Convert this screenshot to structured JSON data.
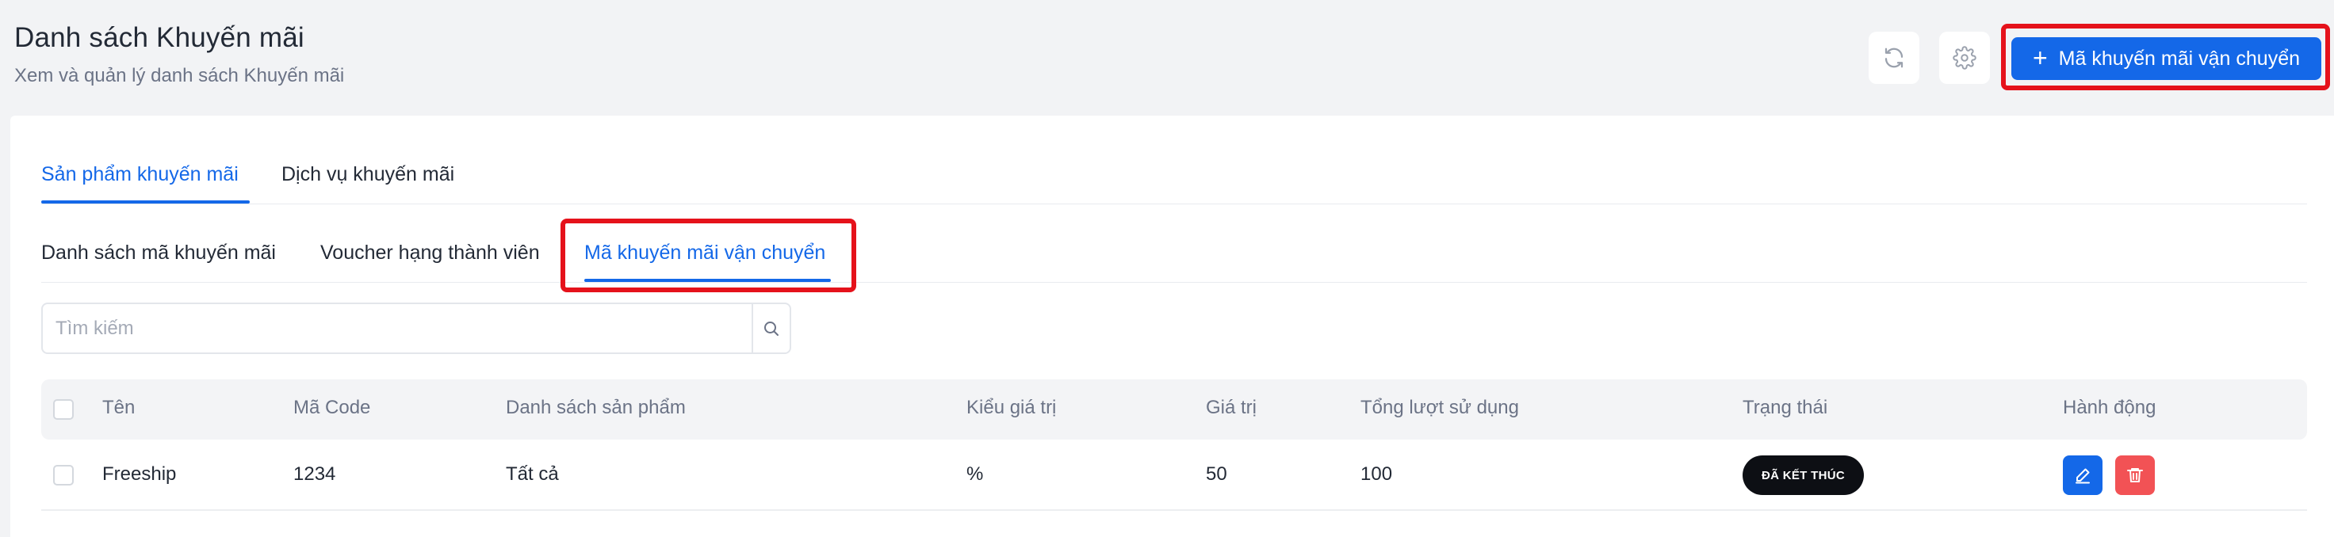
{
  "header": {
    "title": "Danh sách Khuyến mãi",
    "subtitle": "Xem và quản lý danh sách Khuyến mãi",
    "refresh_icon": "refresh-icon",
    "settings_icon": "gear-icon",
    "add_button_label": "Mã khuyến mãi vận chuyển",
    "add_button_icon": "plus-icon"
  },
  "tabs": {
    "main": [
      {
        "label": "Sản phẩm khuyến mãi",
        "active": true
      },
      {
        "label": "Dịch vụ khuyến mãi",
        "active": false
      }
    ],
    "sub": [
      {
        "label": "Danh sách mã khuyến mãi",
        "active": false
      },
      {
        "label": "Voucher hạng thành viên",
        "active": false
      },
      {
        "label": "Mã khuyến mãi vận chuyển",
        "active": true
      }
    ]
  },
  "search": {
    "placeholder": "Tìm kiếm",
    "value": ""
  },
  "table": {
    "columns": [
      "Tên",
      "Mã Code",
      "Danh sách sản phẩm",
      "Kiểu giá trị",
      "Giá trị",
      "Tổng lượt sử dụng",
      "Trạng thái",
      "Hành động"
    ],
    "rows": [
      {
        "name": "Freeship",
        "code": "1234",
        "products": "Tất cả",
        "value_type": "%",
        "value": "50",
        "total_usage": "100",
        "status": "ĐÃ KẾT THÚC"
      }
    ]
  },
  "colors": {
    "accent": "#1468e8",
    "highlight": "#e5121b",
    "danger": "#f25255",
    "status_bg": "#0d0f14"
  }
}
